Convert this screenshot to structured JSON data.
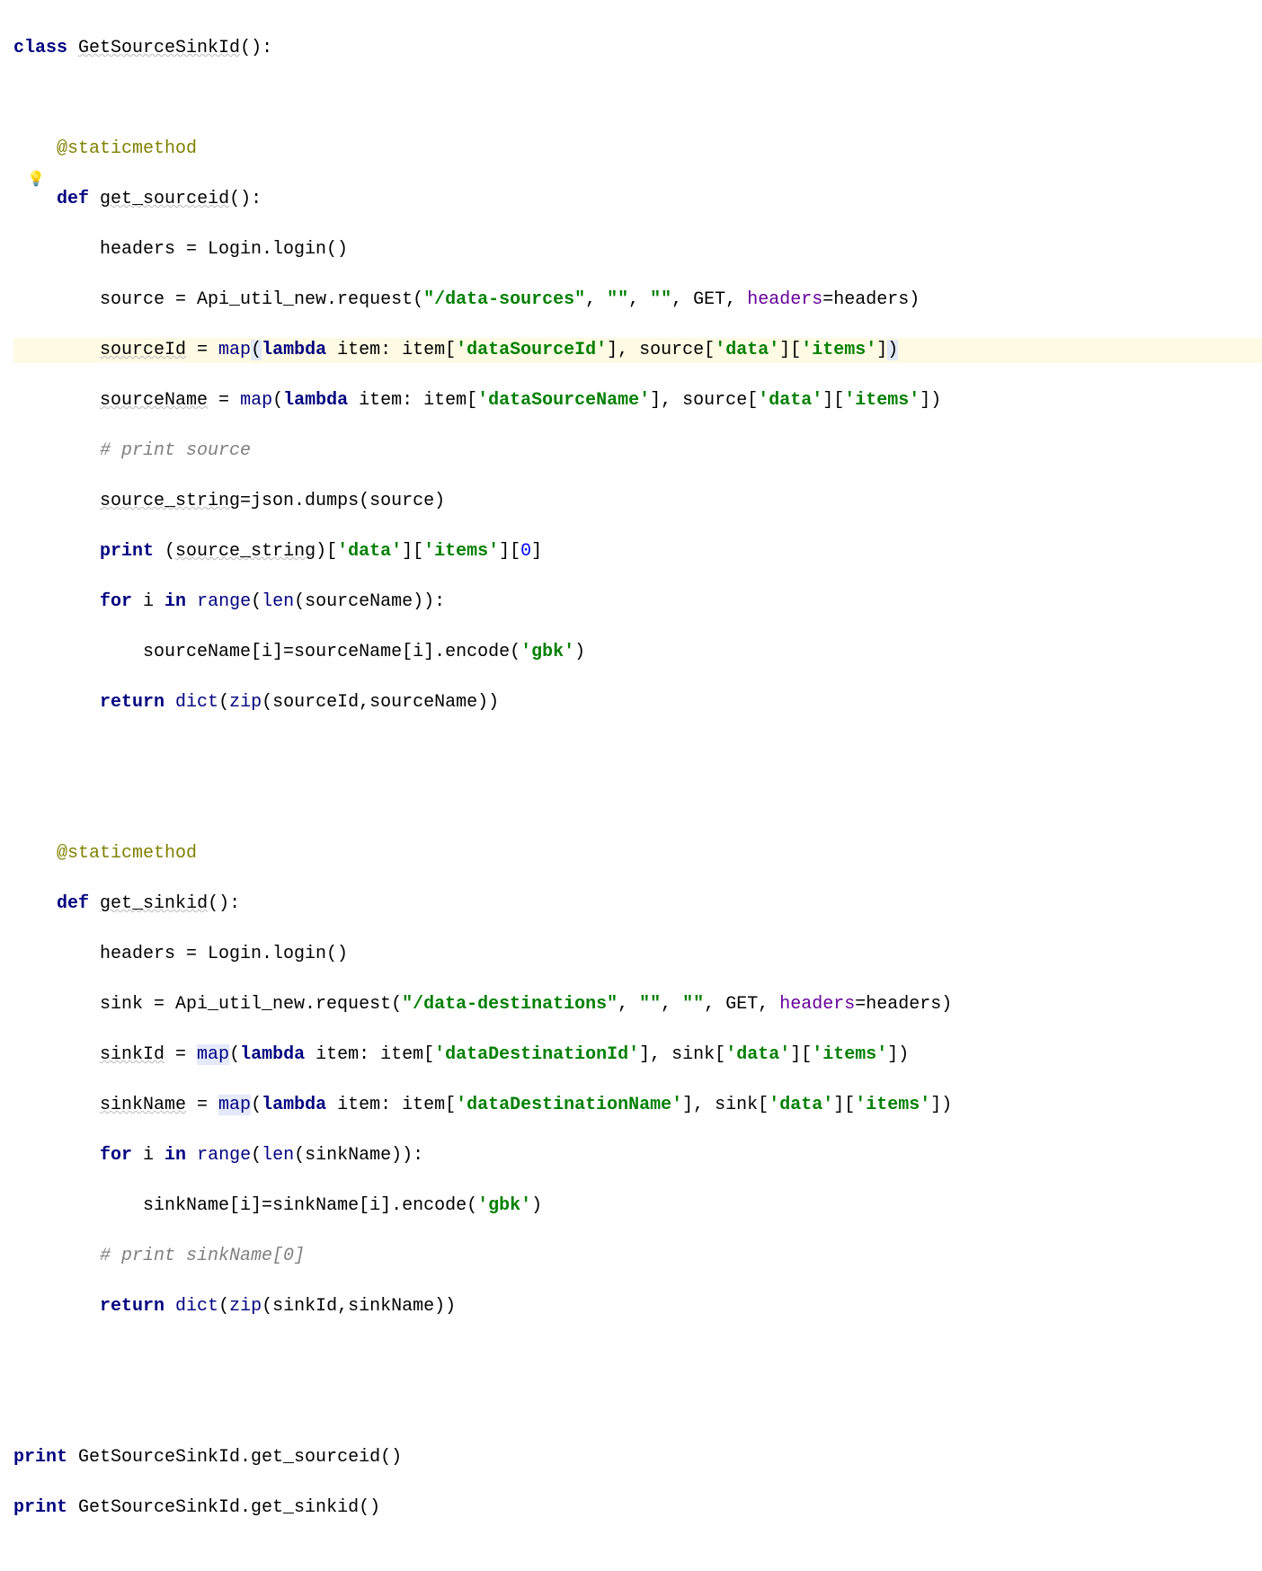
{
  "colors": {
    "keyword": "#000080",
    "decorator": "#808000",
    "string": "#008000",
    "comment": "#808080",
    "parameter": "#660099",
    "highlightLine": "#fffae3"
  },
  "code": {
    "line1": {
      "kw1": "class",
      "name": "GetSourceSinkId",
      "paren": "():"
    },
    "line3": {
      "dec": "@staticmethod"
    },
    "line4": {
      "kw": "def",
      "name": "get_sourceid",
      "paren": "():"
    },
    "line5": {
      "var": "headers = Login.login()"
    },
    "line6": {
      "p1": "source = Api_util_new.request(",
      "s1": "\"/data-sources\"",
      "p2": ", ",
      "s2": "\"\"",
      "p3": ", ",
      "s3": "\"\"",
      "p4": ", GET, ",
      "kw": "headers",
      "p5": "=headers)"
    },
    "line7": {
      "p1": "sourceId",
      "eq": " = ",
      "fn": "map",
      "op": "(",
      "kw": "lambda",
      "p2": " item: item[",
      "s1": "'dataSourceId'",
      "p3": "], source[",
      "s2": "'data'",
      "p4": "][",
      "s3": "'items'",
      "p5": "]",
      ")": ")"
    },
    "line8": {
      "p1": "sourceName",
      "eq": " = ",
      "fn": "map",
      "p2": "(",
      "kw": "lambda",
      "p3": " item: item[",
      "s1": "'dataSourceName'",
      "p4": "], source[",
      "s2": "'data'",
      "p5": "][",
      "s3": "'items'",
      "p6": "])"
    },
    "line9": {
      "cmt": "# print source"
    },
    "line10": {
      "p1": "source_string",
      "p2": "=json.dumps(source)"
    },
    "line11": {
      "kw": "print",
      "p1": " (",
      "p2": "source_string",
      ")": ")[",
      "s1": "'data'",
      "p3": "][",
      "s2": "'items'",
      "p4": "][",
      "n": "0",
      "p5": "]"
    },
    "line12": {
      "kw1": "for",
      "p1": " i ",
      "kw2": "in",
      "p2": " ",
      "fn": "range",
      "p3": "(",
      "fn2": "len",
      "p4": "(sourceName)):"
    },
    "line13": {
      "p1": "sourceName[i]=sourceName[i].encode(",
      "s1": "'gbk'",
      "p2": ")"
    },
    "line14": {
      "kw": "return",
      "p1": " ",
      "fn": "dict",
      "p2": "(",
      "fn2": "zip",
      "p3": "(sourceId,sourceName))"
    },
    "line17": {
      "dec": "@staticmethod"
    },
    "line18": {
      "kw": "def",
      "name": "get_sinkid",
      "paren": "():"
    },
    "line19": {
      "var": "headers = Login.login()"
    },
    "line20": {
      "p1": "sink = Api_util_new.request(",
      "s1": "\"/data-destinations\"",
      "p2": ", ",
      "s2": "\"\"",
      "p3": ", ",
      "s3": "\"\"",
      "p4": ", GET, ",
      "kw": "headers",
      "p5": "=headers)"
    },
    "line21": {
      "p1": "sinkId",
      "eq": " = ",
      "fn": "map",
      "p2": "(",
      "kw": "lambda",
      "p3": " item: item[",
      "s1": "'dataDestinationId'",
      "p4": "], sink[",
      "s2": "'data'",
      "p5": "][",
      "s3": "'items'",
      "p6": "])"
    },
    "line22": {
      "p1": "sinkName",
      "eq": " = ",
      "fn": "map",
      "p2": "(",
      "kw": "lambda",
      "p3": " item: item[",
      "s1": "'dataDestinationName'",
      "p4": "], sink[",
      "s2": "'data'",
      "p5": "][",
      "s3": "'items'",
      "p6": "])"
    },
    "line23": {
      "kw1": "for",
      "p1": " i ",
      "kw2": "in",
      "p2": " ",
      "fn": "range",
      "p3": "(",
      "fn2": "len",
      "p4": "(sinkName)):"
    },
    "line24": {
      "p1": "sinkName[i]=sinkName[i].encode(",
      "s1": "'gbk'",
      "p2": ")"
    },
    "line25": {
      "cmt": "# print sinkName[0]"
    },
    "line26": {
      "kw": "return",
      "p1": " ",
      "fn": "dict",
      "p2": "(",
      "fn2": "zip",
      "p3": "(sinkId,sinkName))"
    },
    "line29": {
      "kw": "print",
      "p1": " GetSourceSinkId.get_sourceid()"
    },
    "line30": {
      "kw": "print",
      "p1": " GetSourceSinkId.get_sinkid()"
    }
  }
}
